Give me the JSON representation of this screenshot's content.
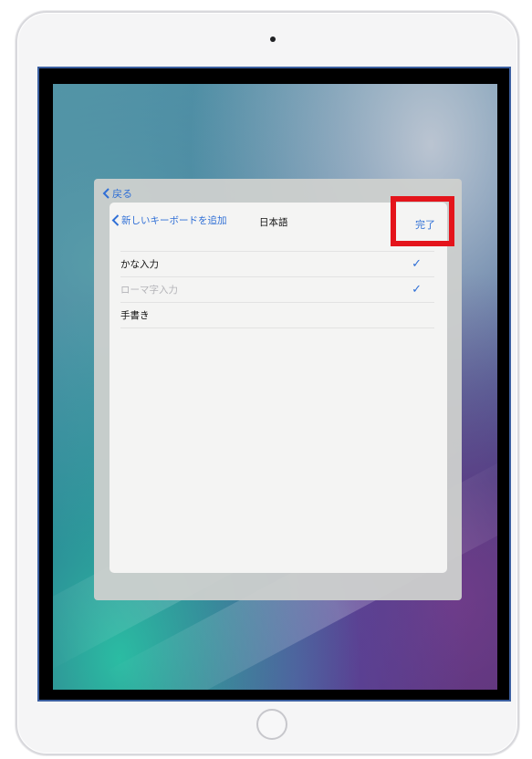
{
  "back_link": {
    "label": "戻る"
  },
  "modal": {
    "back_label": "新しいキーボードを追加",
    "title": "日本語",
    "done_label": "完了"
  },
  "keyboards": [
    {
      "label": "かな入力",
      "checked": true,
      "enabled": true
    },
    {
      "label": "ローマ字入力",
      "checked": true,
      "enabled": false
    },
    {
      "label": "手書き",
      "checked": false,
      "enabled": true
    }
  ],
  "colors": {
    "accent": "#2f6fd6",
    "highlight": "#e4141b"
  },
  "icons": {
    "back": "chevron-left-icon",
    "check": "checkmark-icon"
  }
}
